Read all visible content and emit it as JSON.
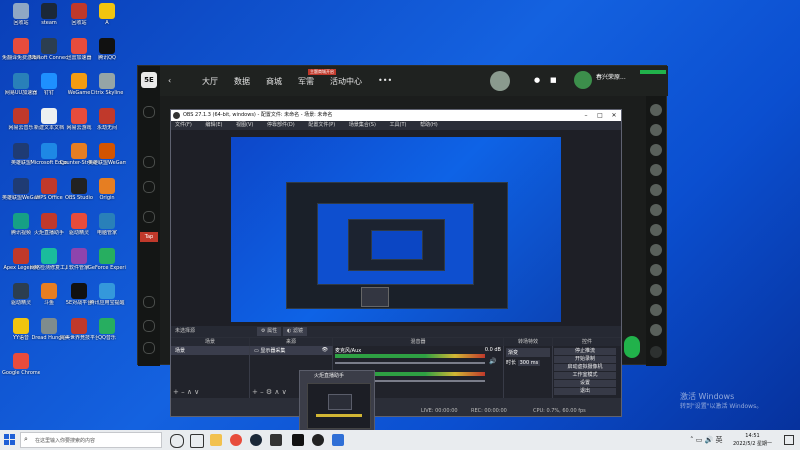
{
  "desktop": {
    "icons": [
      {
        "label": "回收站",
        "color": "#8fa7c4"
      },
      {
        "label": "steam",
        "color": "#1b2838"
      },
      {
        "label": "回收站",
        "color": "#c0392b"
      },
      {
        "label": "A",
        "color": "#f1c40f"
      },
      {
        "label": "免翻译免费游戏平台",
        "color": "#e74c3c"
      },
      {
        "label": "Ubisoft Connect",
        "color": "#2c3e50"
      },
      {
        "label": "迅雷加速器",
        "color": "#e74c3c"
      },
      {
        "label": "腾讯QQ",
        "color": "#111"
      },
      {
        "label": "网易UU加速器",
        "color": "#2980b9"
      },
      {
        "label": "钉钉",
        "color": "#1e90ff"
      },
      {
        "label": "WeGame",
        "color": "#f39c12"
      },
      {
        "label": "Citrix Skyline",
        "color": "#95a5a6"
      },
      {
        "label": "网易云音乐",
        "color": "#c0392b"
      },
      {
        "label": "新建文本文档",
        "color": "#ecf0f1"
      },
      {
        "label": "网易云游戏",
        "color": "#e74c3c"
      },
      {
        "label": "永劫无间",
        "color": "#c0392b"
      },
      {
        "label": "英雄联盟",
        "color": "#1f3b73"
      },
      {
        "label": "Microsoft Edge",
        "color": "#1e88e5"
      },
      {
        "label": "Counter-Strike Global Off...",
        "color": "#e67e22"
      },
      {
        "label": "英雄联盟WeGame版",
        "color": "#d35400"
      },
      {
        "label": "英雄联盟WeGame版",
        "color": "#1f3b73"
      },
      {
        "label": "WPS Office",
        "color": "#c0392b"
      },
      {
        "label": "OBS Studio",
        "color": "#222"
      },
      {
        "label": "Origin",
        "color": "#e67e22"
      },
      {
        "label": "腾讯视频",
        "color": "#16a085"
      },
      {
        "label": "火炬直播助手",
        "color": "#c0392b"
      },
      {
        "label": "驱动精灵",
        "color": "#e74c3c"
      },
      {
        "label": "电脑管家",
        "color": "#2980b9"
      },
      {
        "label": "Apex Legends",
        "color": "#c0392b"
      },
      {
        "label": "网络检测修复工具",
        "color": "#1abc9c"
      },
      {
        "label": "软件管家",
        "color": "#8e44ad"
      },
      {
        "label": "GeForce Experience",
        "color": "#27ae60"
      },
      {
        "label": "驱动精灵",
        "color": "#2c3e50"
      },
      {
        "label": "斗鱼",
        "color": "#e67e22"
      },
      {
        "label": "5E对战平台",
        "color": "#111"
      },
      {
        "label": "腾讯应用宝提醒",
        "color": "#3498db"
      },
      {
        "label": "YY语音",
        "color": "#f1c40f"
      },
      {
        "label": "Dread Hunger",
        "color": "#7f8c8d"
      },
      {
        "label": "完美世界竞技平台",
        "color": "#c0392b"
      },
      {
        "label": "QQ音乐",
        "color": "#27ae60"
      },
      {
        "label": "Google Chrome",
        "color": "#e74c3c"
      }
    ]
  },
  "client5e": {
    "logo": "5E",
    "nav": [
      "大厅",
      "数据",
      "商城",
      "军需",
      "活动中心",
      "•••"
    ],
    "nav_badge": "主题商城开启",
    "username": "春兴荣原..."
  },
  "obs": {
    "title": "OBS 27.1.3 (64-bit, windows) - 配置文件: 未命名 - 场景: 未命名",
    "menu": [
      "文件(F)",
      "编辑(E)",
      "视图(V)",
      "停靠部件(D)",
      "配置文件(P)",
      "场景集合(S)",
      "工具(T)",
      "帮助(H)"
    ],
    "source_label": "未选择源",
    "props_btn": "属性",
    "filter_btn": "滤镜",
    "docks": {
      "scenes": "场景",
      "sources": "来源",
      "mixer": "混音器",
      "transitions": "转场特效",
      "controls": "控件"
    },
    "scene_item": "场景",
    "source_item": "显示器采集",
    "mixer_item": "麦克风/Aux",
    "mixer_level": "0.0 dB",
    "transition_value": "渐变",
    "duration_label": "时长",
    "duration_value": "300 ms",
    "control_buttons": [
      "停止推流",
      "开始录制",
      "启动虚拟摄像机",
      "工作室模式",
      "设置",
      "退出"
    ],
    "status": {
      "live": "LIVE: 00:00:00",
      "rec": "REC: 00:00:00",
      "cpu": "CPU: 0.7%, 60.00 fps"
    }
  },
  "popup": {
    "title": "火炬直播助手"
  },
  "watermark": {
    "line1": "激活 Windows",
    "line2": "转到\"设置\"以激活 Windows。"
  },
  "taskbar": {
    "search_placeholder": "在这里输入你要搜索的内容",
    "time": "14:51",
    "date": "2022/5/2 星期一"
  }
}
